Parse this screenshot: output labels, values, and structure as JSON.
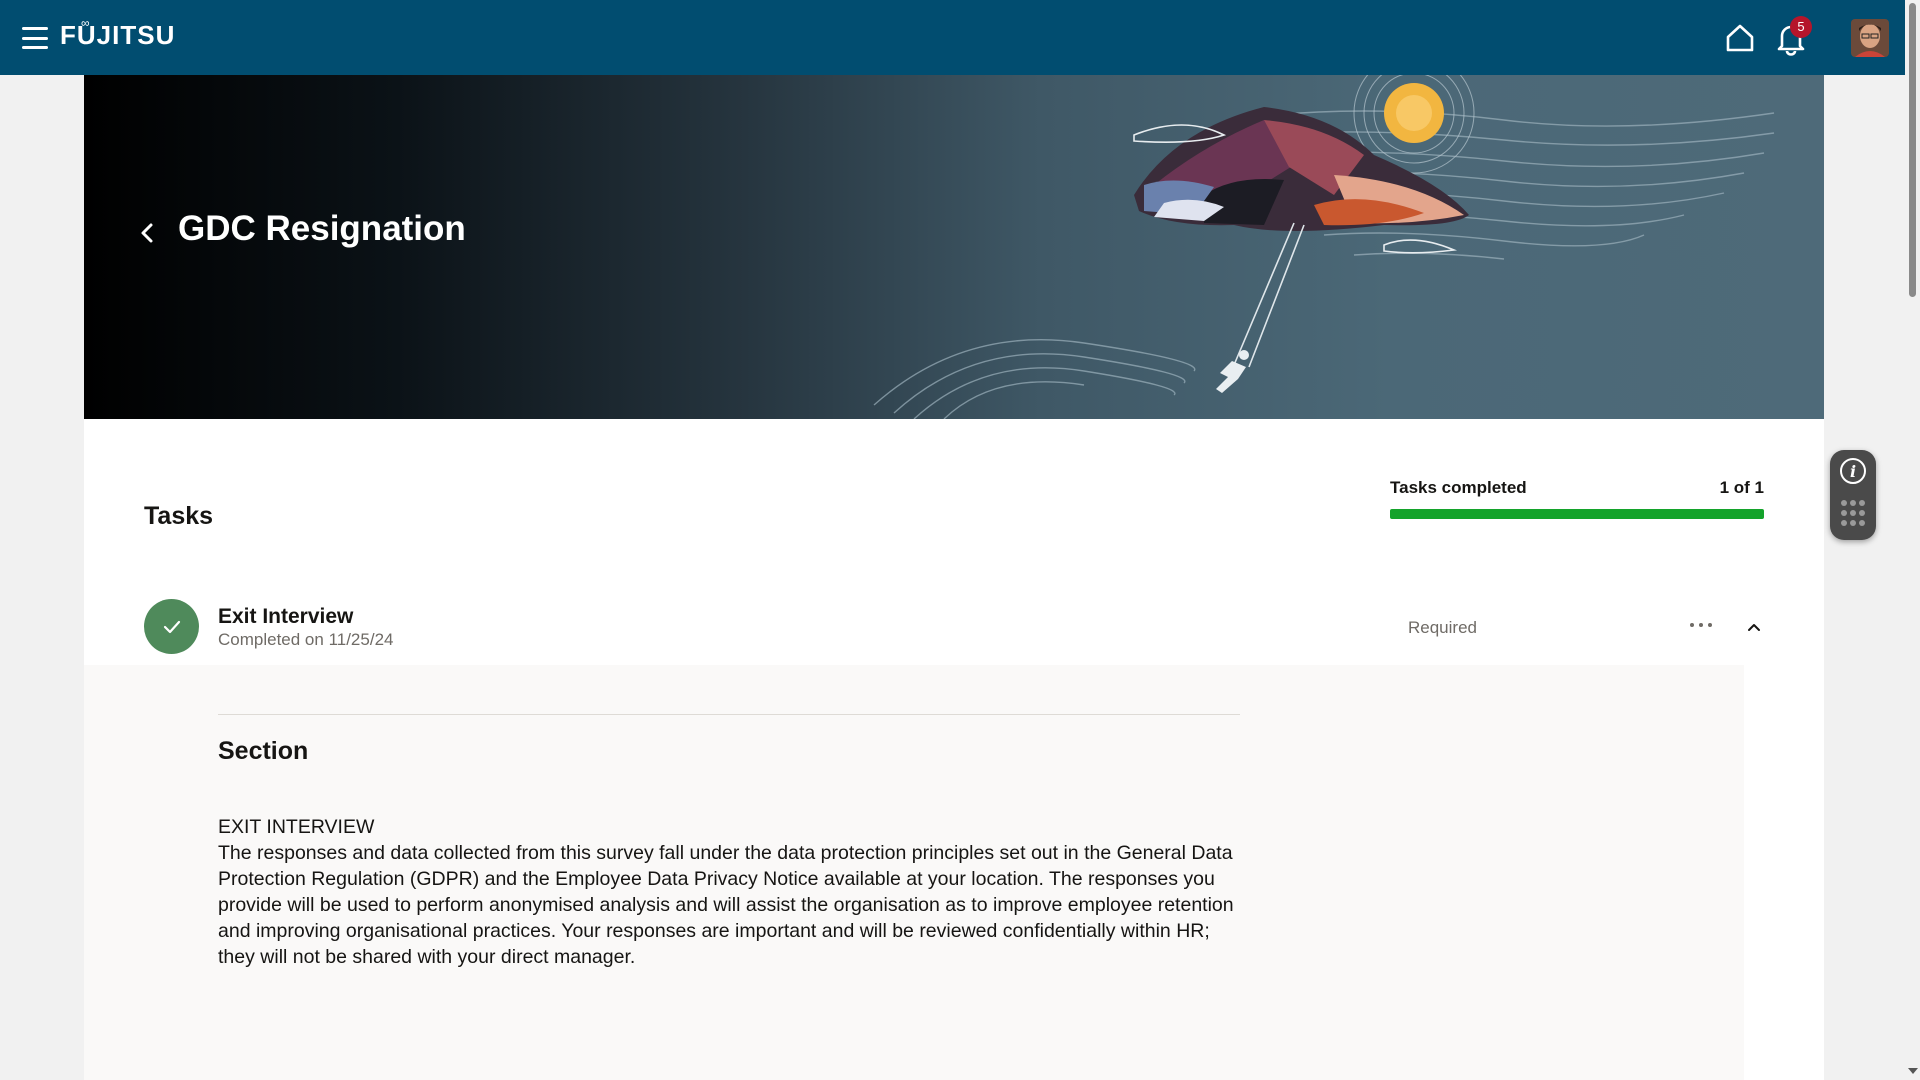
{
  "app": {
    "brand": "FUJITSU",
    "notifications_count": "5"
  },
  "page": {
    "title": "GDC Resignation"
  },
  "tasks": {
    "heading": "Tasks",
    "progress_label": "Tasks completed",
    "progress_count": "1 of 1",
    "progress_fraction": 1.0,
    "items": [
      {
        "name": "Exit Interview",
        "status": "Completed on 11/25/24",
        "requirement": "Required"
      }
    ]
  },
  "section": {
    "title": "Section",
    "heading_line": "EXIT INTERVIEW",
    "body": "The responses and data collected from this survey fall under the data protection principles set out in the General Data Protection Regulation (GDPR) and the Employee Data Privacy Notice available at your location. The responses you provide will be used to perform anonymised analysis and will assist the organisation as to improve employee retention and improving organisational practices. Your responses are important and will be reviewed confidentially within HR; they will not be shared with your direct manager."
  },
  "colors": {
    "topbar": "#014d70",
    "progress_fill": "#14a32b",
    "check_badge": "#4f8a5b",
    "notification_badge": "#b5152b"
  }
}
